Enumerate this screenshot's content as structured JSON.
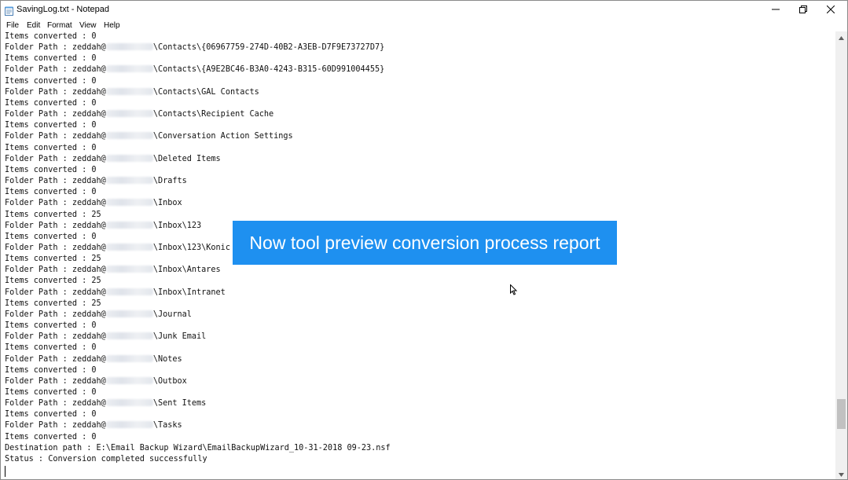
{
  "window": {
    "title": "SavingLog.txt - Notepad",
    "icons": {
      "app": "notepad-icon",
      "minimize": "minimize-icon",
      "maximize": "restore-icon",
      "close": "close-icon"
    }
  },
  "menu": {
    "file": "File",
    "edit": "Edit",
    "format": "Format",
    "view": "View",
    "help": "Help"
  },
  "log": {
    "lines": [
      {
        "prefix": "Items converted : 0",
        "suffix": ""
      },
      {
        "prefix": "Folder Path : zeddah@",
        "suffix": "\\Contacts\\{06967759-274D-40B2-A3EB-D7F9E73727D7}"
      },
      {
        "prefix": "Items converted : 0",
        "suffix": ""
      },
      {
        "prefix": "Folder Path : zeddah@",
        "suffix": "\\Contacts\\{A9E2BC46-B3A0-4243-B315-60D991004455}"
      },
      {
        "prefix": "Items converted : 0",
        "suffix": ""
      },
      {
        "prefix": "Folder Path : zeddah@",
        "suffix": "\\Contacts\\GAL Contacts"
      },
      {
        "prefix": "Items converted : 0",
        "suffix": ""
      },
      {
        "prefix": "Folder Path : zeddah@",
        "suffix": "\\Contacts\\Recipient Cache"
      },
      {
        "prefix": "Items converted : 0",
        "suffix": ""
      },
      {
        "prefix": "Folder Path : zeddah@",
        "suffix": "\\Conversation Action Settings"
      },
      {
        "prefix": "Items converted : 0",
        "suffix": ""
      },
      {
        "prefix": "Folder Path : zeddah@",
        "suffix": "\\Deleted Items"
      },
      {
        "prefix": "Items converted : 0",
        "suffix": ""
      },
      {
        "prefix": "Folder Path : zeddah@",
        "suffix": "\\Drafts"
      },
      {
        "prefix": "Items converted : 0",
        "suffix": ""
      },
      {
        "prefix": "Folder Path : zeddah@",
        "suffix": "\\Inbox"
      },
      {
        "prefix": "Items converted : 25",
        "suffix": ""
      },
      {
        "prefix": "Folder Path : zeddah@",
        "suffix": "\\Inbox\\123"
      },
      {
        "prefix": "Items converted : 0",
        "suffix": ""
      },
      {
        "prefix": "Folder Path : zeddah@",
        "suffix": "\\Inbox\\123\\Konic"
      },
      {
        "prefix": "Items converted : 25",
        "suffix": ""
      },
      {
        "prefix": "Folder Path : zeddah@",
        "suffix": "\\Inbox\\Antares"
      },
      {
        "prefix": "Items converted : 25",
        "suffix": ""
      },
      {
        "prefix": "Folder Path : zeddah@",
        "suffix": "\\Inbox\\Intranet"
      },
      {
        "prefix": "Items converted : 25",
        "suffix": ""
      },
      {
        "prefix": "Folder Path : zeddah@",
        "suffix": "\\Journal"
      },
      {
        "prefix": "Items converted : 0",
        "suffix": ""
      },
      {
        "prefix": "Folder Path : zeddah@",
        "suffix": "\\Junk Email"
      },
      {
        "prefix": "Items converted : 0",
        "suffix": ""
      },
      {
        "prefix": "Folder Path : zeddah@",
        "suffix": "\\Notes"
      },
      {
        "prefix": "Items converted : 0",
        "suffix": ""
      },
      {
        "prefix": "Folder Path : zeddah@",
        "suffix": "\\Outbox"
      },
      {
        "prefix": "Items converted : 0",
        "suffix": ""
      },
      {
        "prefix": "Folder Path : zeddah@",
        "suffix": "\\Sent Items"
      },
      {
        "prefix": "Items converted : 0",
        "suffix": ""
      },
      {
        "prefix": "Folder Path : zeddah@",
        "suffix": "\\Tasks"
      },
      {
        "prefix": "Items converted : 0",
        "suffix": ""
      },
      {
        "prefix": "Destination path : E:\\Email Backup Wizard\\EmailBackupWizard_10-31-2018 09-23.nsf",
        "suffix": ""
      },
      {
        "prefix": "Status : Conversion completed successfully",
        "suffix": ""
      }
    ]
  },
  "overlay": {
    "text": "Now tool preview conversion process report",
    "color": "#1e90f0"
  },
  "scrollbar": {
    "position": 0.9
  }
}
